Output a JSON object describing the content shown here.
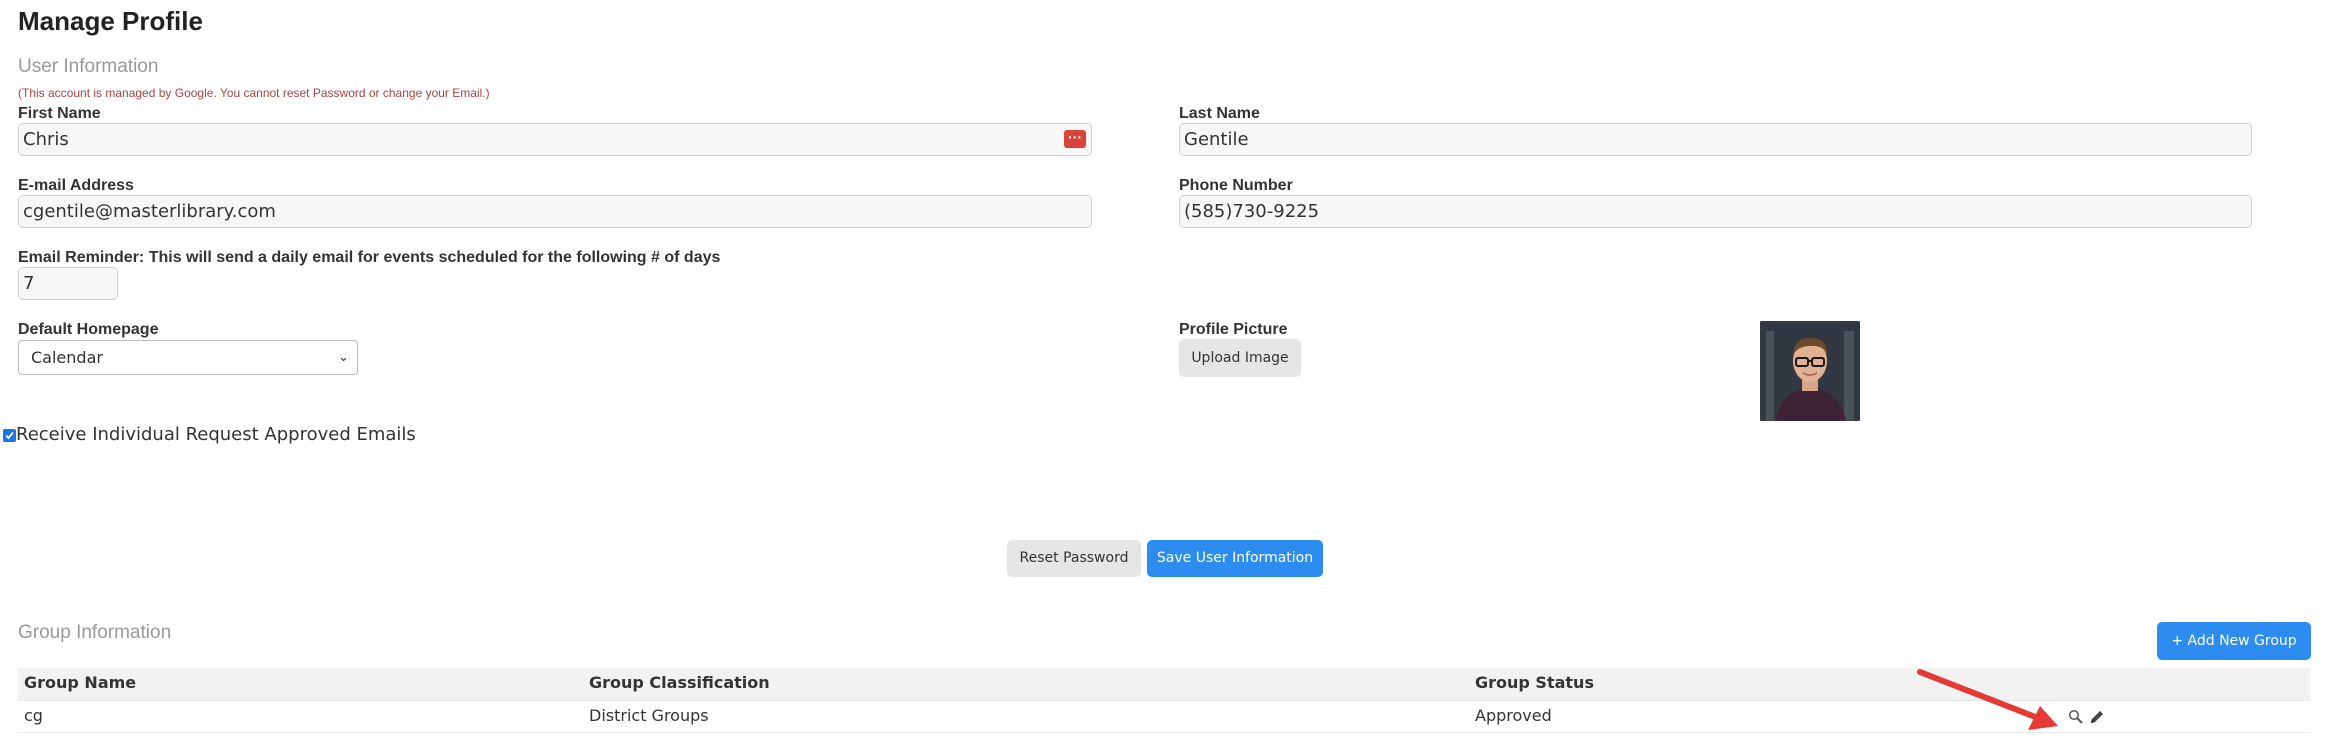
{
  "page_title": "Manage Profile",
  "user_info": {
    "section_title": "User Information",
    "google_note": "(This account is managed by Google. You cannot reset Password or change your Email.)",
    "first_name_label": "First Name",
    "first_name_value": "Chris",
    "last_name_label": "Last Name",
    "last_name_value": "Gentile",
    "email_label": "E-mail Address",
    "email_value": "cgentile@masterlibrary.com",
    "phone_label": "Phone Number",
    "phone_value": "(585)730-9225",
    "reminder_label": "Email Reminder: This will send a daily email for events scheduled for the following # of days",
    "reminder_value": "7",
    "homepage_label": "Default Homepage",
    "homepage_selected": "Calendar",
    "profile_picture_label": "Profile Picture",
    "upload_button": "Upload Image",
    "approved_emails_label": "Receive Individual Request Approved Emails",
    "approved_emails_checked": true,
    "reset_password_button": "Reset Password",
    "save_button": "Save User Information"
  },
  "group_info": {
    "section_title": "Group Information",
    "add_group_button": "+ Add New Group",
    "columns": [
      "Group Name",
      "Group Classification",
      "Group Status"
    ],
    "rows": [
      {
        "name": "cg",
        "classification": "District Groups",
        "status": "Approved"
      }
    ]
  },
  "icons": {
    "password_manager": "password-manager-icon",
    "view": "magnifier-icon",
    "edit": "pencil-icon",
    "annotation": "red-arrow"
  },
  "colors": {
    "primary": "#2d8cf0",
    "note": "#a94442",
    "annotation": "#e53935"
  }
}
